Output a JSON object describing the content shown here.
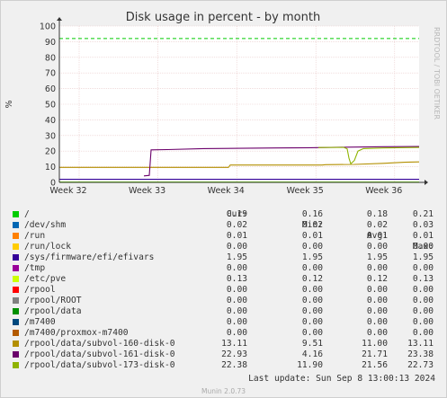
{
  "chart_data": {
    "type": "line",
    "title": "Disk usage in percent - by month",
    "ylabel": "%",
    "side_label": "RRDTOOL / TOBI OETIKER",
    "ylim": [
      0,
      100
    ],
    "yticks": [
      0,
      10,
      20,
      30,
      40,
      50,
      60,
      70,
      80,
      90,
      100
    ],
    "xlim": [
      0,
      1
    ],
    "xticks": [
      {
        "label": "Week 32",
        "pos": 0.055
      },
      {
        "label": "Week 33",
        "pos": 0.274
      },
      {
        "label": "Week 34",
        "pos": 0.493
      },
      {
        "label": "Week 35",
        "pos": 0.713
      },
      {
        "label": "Week 36",
        "pos": 0.932
      }
    ],
    "reference_line": {
      "value": 92,
      "color": "#00cc00",
      "style": "dashed"
    },
    "series": [
      {
        "name": "/",
        "color": "#00cc00",
        "points": [
          [
            0,
            0.19
          ],
          [
            1,
            0.19
          ]
        ]
      },
      {
        "name": "/dev/shm",
        "color": "#0066b3",
        "points": [
          [
            0,
            0.02
          ],
          [
            1,
            0.02
          ]
        ]
      },
      {
        "name": "/run",
        "color": "#ff8000",
        "points": [
          [
            0,
            0.01
          ],
          [
            1,
            0.01
          ]
        ]
      },
      {
        "name": "/run/lock",
        "color": "#ffcc00",
        "points": [
          [
            0,
            0.0
          ],
          [
            1,
            0.0
          ]
        ]
      },
      {
        "name": "/sys/firmware/efi/efivars",
        "color": "#330099",
        "points": [
          [
            0,
            1.95
          ],
          [
            1,
            1.95
          ]
        ]
      },
      {
        "name": "/tmp",
        "color": "#990099",
        "points": [
          [
            0,
            0.0
          ],
          [
            1,
            0.0
          ]
        ]
      },
      {
        "name": "/etc/pve",
        "color": "#ccff00",
        "points": [
          [
            0,
            0.13
          ],
          [
            1,
            0.13
          ]
        ]
      },
      {
        "name": "/rpool",
        "color": "#ff0000",
        "points": [
          [
            0,
            0.0
          ],
          [
            1,
            0.0
          ]
        ]
      },
      {
        "name": "/rpool/ROOT",
        "color": "#808080",
        "points": [
          [
            0,
            0.0
          ],
          [
            1,
            0.0
          ]
        ]
      },
      {
        "name": "/rpool/data",
        "color": "#008f00",
        "points": [
          [
            0,
            0.0
          ],
          [
            1,
            0.0
          ]
        ]
      },
      {
        "name": "/m7400",
        "color": "#00487d",
        "points": [
          [
            0,
            0.0
          ],
          [
            1,
            0.0
          ]
        ]
      },
      {
        "name": "/m7400/proxmox-m7400",
        "color": "#b35a00",
        "points": [
          [
            0,
            0.0
          ],
          [
            1,
            0.0
          ]
        ]
      },
      {
        "name": "/rpool/data/subvol-160-disk-0",
        "color": "#b38f00",
        "points": [
          [
            0,
            9.6
          ],
          [
            0.25,
            9.6
          ],
          [
            0.47,
            9.6
          ],
          [
            0.475,
            11.1
          ],
          [
            0.73,
            11.1
          ],
          [
            0.74,
            11.3
          ],
          [
            0.82,
            11.5
          ],
          [
            0.9,
            12.2
          ],
          [
            0.96,
            12.9
          ],
          [
            1,
            13.11
          ]
        ]
      },
      {
        "name": "/rpool/data/subvol-161-disk-0",
        "color": "#6b006b",
        "points": [
          [
            0.235,
            4.16
          ],
          [
            0.25,
            4.5
          ],
          [
            0.255,
            20.8
          ],
          [
            0.3,
            21.0
          ],
          [
            0.4,
            21.6
          ],
          [
            0.5,
            21.8
          ],
          [
            0.6,
            22.0
          ],
          [
            0.7,
            22.2
          ],
          [
            0.8,
            22.5
          ],
          [
            0.9,
            22.8
          ],
          [
            1,
            22.93
          ]
        ]
      },
      {
        "name": "/rpool/data/subvol-173-disk-0",
        "color": "#8fb300",
        "points": [
          [
            0.72,
            22.3
          ],
          [
            0.79,
            22.4
          ],
          [
            0.8,
            21.5
          ],
          [
            0.805,
            15.5
          ],
          [
            0.81,
            11.9
          ],
          [
            0.82,
            14.0
          ],
          [
            0.83,
            20.0
          ],
          [
            0.845,
            21.6
          ],
          [
            0.9,
            22.0
          ],
          [
            1,
            22.38
          ]
        ]
      }
    ],
    "legend": {
      "headers": [
        "Cur:",
        "Min:",
        "Avg:",
        "Max:"
      ],
      "rows": [
        {
          "name": "/",
          "color": "#00cc00",
          "cur": "0.19",
          "min": "0.16",
          "avg": "0.18",
          "max": "0.21"
        },
        {
          "name": "/dev/shm",
          "color": "#0066b3",
          "cur": "0.02",
          "min": "0.02",
          "avg": "0.02",
          "max": "0.03"
        },
        {
          "name": "/run",
          "color": "#ff8000",
          "cur": "0.01",
          "min": "0.01",
          "avg": "0.01",
          "max": "0.01"
        },
        {
          "name": "/run/lock",
          "color": "#ffcc00",
          "cur": "0.00",
          "min": "0.00",
          "avg": "0.00",
          "max": "0.00"
        },
        {
          "name": "/sys/firmware/efi/efivars",
          "color": "#330099",
          "cur": "1.95",
          "min": "1.95",
          "avg": "1.95",
          "max": "1.95"
        },
        {
          "name": "/tmp",
          "color": "#990099",
          "cur": "0.00",
          "min": "0.00",
          "avg": "0.00",
          "max": "0.00"
        },
        {
          "name": "/etc/pve",
          "color": "#ccff00",
          "cur": "0.13",
          "min": "0.12",
          "avg": "0.12",
          "max": "0.13"
        },
        {
          "name": "/rpool",
          "color": "#ff0000",
          "cur": "0.00",
          "min": "0.00",
          "avg": "0.00",
          "max": "0.00"
        },
        {
          "name": "/rpool/ROOT",
          "color": "#808080",
          "cur": "0.00",
          "min": "0.00",
          "avg": "0.00",
          "max": "0.00"
        },
        {
          "name": "/rpool/data",
          "color": "#008f00",
          "cur": "0.00",
          "min": "0.00",
          "avg": "0.00",
          "max": "0.00"
        },
        {
          "name": "/m7400",
          "color": "#00487d",
          "cur": "0.00",
          "min": "0.00",
          "avg": "0.00",
          "max": "0.00"
        },
        {
          "name": "/m7400/proxmox-m7400",
          "color": "#b35a00",
          "cur": "0.00",
          "min": "0.00",
          "avg": "0.00",
          "max": "0.00"
        },
        {
          "name": "/rpool/data/subvol-160-disk-0",
          "color": "#b38f00",
          "cur": "13.11",
          "min": "9.51",
          "avg": "11.00",
          "max": "13.11"
        },
        {
          "name": "/rpool/data/subvol-161-disk-0",
          "color": "#6b006b",
          "cur": "22.93",
          "min": "4.16",
          "avg": "21.71",
          "max": "23.38"
        },
        {
          "name": "/rpool/data/subvol-173-disk-0",
          "color": "#8fb300",
          "cur": "22.38",
          "min": "11.90",
          "avg": "21.56",
          "max": "22.73"
        }
      ]
    }
  },
  "last_update": "Last update: Sun Sep  8 13:00:13 2024",
  "footer": "Munin 2.0.73"
}
